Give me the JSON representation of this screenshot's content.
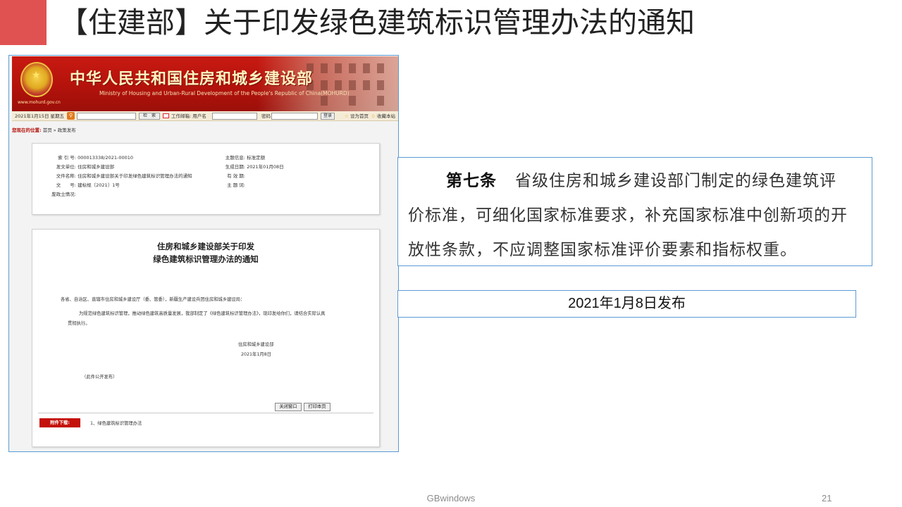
{
  "slide": {
    "title": "【住建部】关于印发绿色建筑标识管理办法的通知",
    "accent_color": "#e05252",
    "footer_center": "GBwindows",
    "page_number": "21"
  },
  "screenshot": {
    "banner": {
      "site_name_cn": "中华人民共和国住房和城乡建设部",
      "site_name_en": "Ministry of Housing and Urban-Rural Development of the People's Republic of China(MOHURD)",
      "url": "www.mohurd.gov.cn",
      "emblem_icon": "national-emblem-icon",
      "brand_color": "#c81a12"
    },
    "toolbar": {
      "date": "2021年1月15日 星期五",
      "search_button": "检　索",
      "mail_label": "工作邮箱: 用户名",
      "password_label": "密码",
      "login_button": "登录",
      "set_home": "设为首页",
      "bookmark": "收藏本站"
    },
    "breadcrumb": {
      "lead": "您现在的位置:",
      "path": "首页 » 政策发布"
    },
    "meta": {
      "index_no_label": "索 引 号:",
      "index_no": "000013338/2021-00010",
      "issuer_label": "发文单位:",
      "issuer": "住房和城乡建设部",
      "doc_name_label": "文件名称:",
      "doc_name": "住房和城乡建设部关于印发绿色建筑标识管理办法的通知",
      "doc_no_label": "文　　号:",
      "doc_no": "建标规〔2021〕1号",
      "status_label": "废政立情况:",
      "status": "",
      "topic_label": "主题信息:",
      "topic": "标准定额",
      "date_label": "生成日期:",
      "date": "2021年01月08日",
      "validity_label": "有 效 期:",
      "validity": "",
      "subject_label": "主 题 词:",
      "subject": ""
    },
    "document": {
      "title_line1": "住房和城乡建设部关于印发",
      "title_line2": "绿色建筑标识管理办法的通知",
      "salutation": "各省、自治区、直辖市住房和城乡建设厅（委、管委），新疆生产建设兵团住房和城乡建设局：",
      "body_line1": "为规范绿色建筑标识管理，推动绿色建筑高质量发展，我部制定了《绿色建筑标识管理办法》，现印发给你们，请结合实际认真",
      "body_line2": "贯彻执行。",
      "signature": "住房和城乡建设部",
      "sign_date": "2021年1月8日",
      "disclosure": "（此件公开发布）",
      "close_button": "关闭窗口",
      "print_button": "打印本页",
      "attachment_label": "附件下载:",
      "attachment_item": "1、绿色建筑标识管理办法"
    }
  },
  "callouts": {
    "article_number": "第七条",
    "article_line1": "省级住房和城乡建设部门制定的绿色建筑评",
    "article_line2": "价标准，可细化国家标准要求，补充国家标准中创新项的开",
    "article_line3": "放性条款，不应调整国家标准评价要素和指标权重。",
    "release_date": "2021年1月8日发布",
    "border_color": "#5b9bd5"
  }
}
